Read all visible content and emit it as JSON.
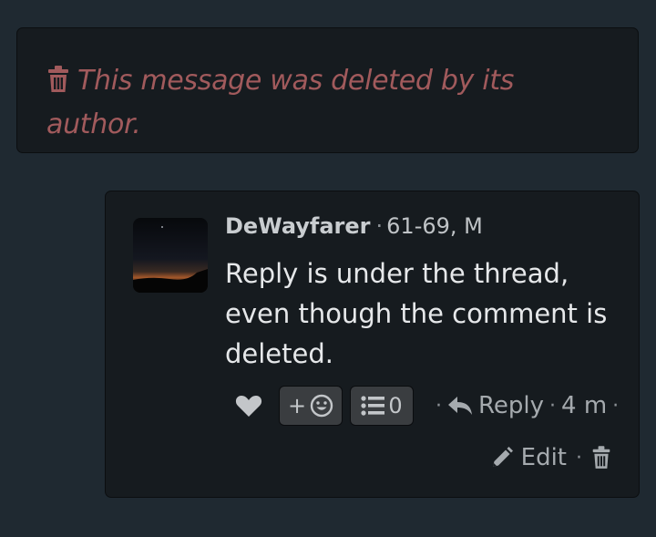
{
  "deleted_message": {
    "text": "This message was deleted by its author.",
    "icon": "trash-icon",
    "color": "#a15a5c"
  },
  "comment": {
    "username": "DeWayfarer",
    "separator": "·",
    "user_info": "61-69, M",
    "body": "Reply is under the thread, even though the comment is deleted.",
    "actions": {
      "like_icon": "heart-icon",
      "react_label": "+",
      "react_icon": "smiley-icon",
      "list_icon": "list-icon",
      "list_count": "0",
      "reply_label": "Reply",
      "time": "4 m",
      "edit_label": "Edit",
      "delete_icon": "trash-icon"
    }
  }
}
